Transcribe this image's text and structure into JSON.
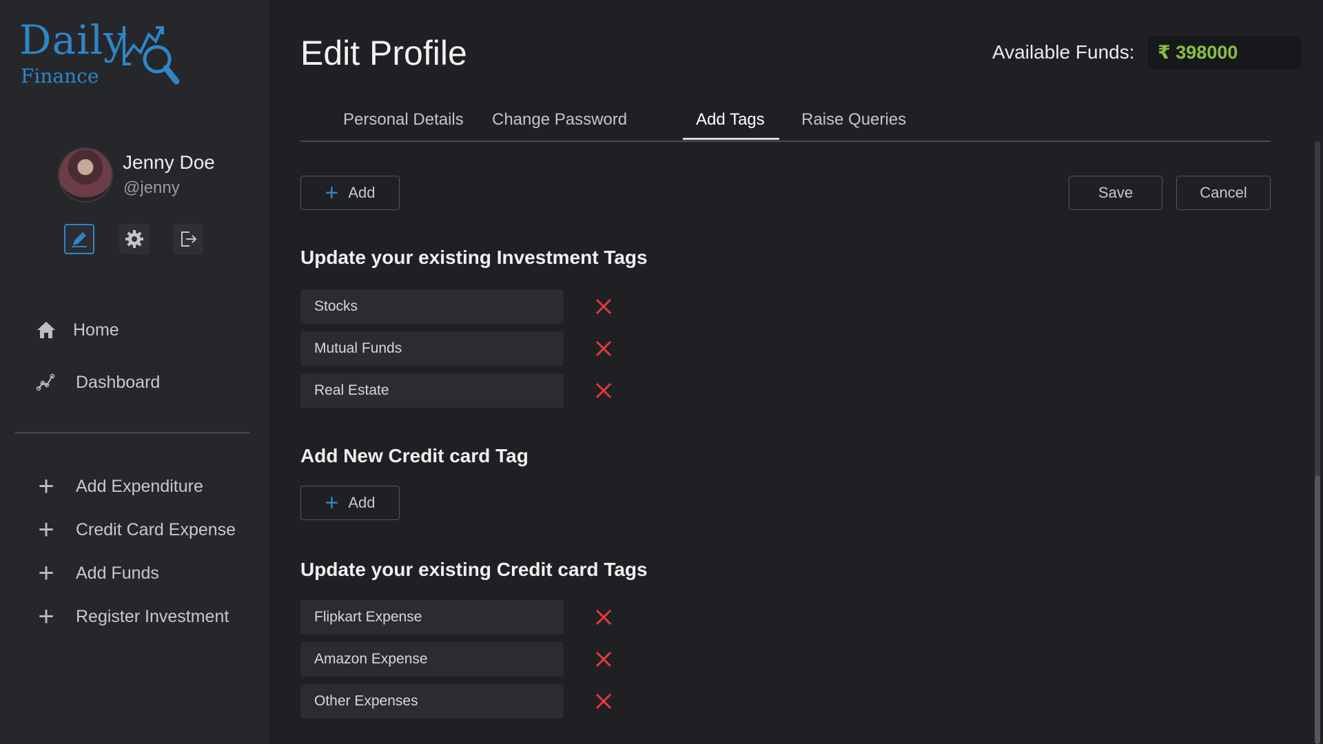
{
  "brand": {
    "name_top": "Daily",
    "name_bottom": "Finance",
    "accent": "#2f86c8"
  },
  "user": {
    "name": "Jenny Doe",
    "handle": "@jenny"
  },
  "quick_actions": [
    {
      "icon": "pencil-icon",
      "label": "Edit"
    },
    {
      "icon": "gear-icon",
      "label": "Settings"
    },
    {
      "icon": "logout-icon",
      "label": "Logout"
    }
  ],
  "nav": {
    "primary": [
      {
        "label": "Home",
        "icon": "home-icon"
      },
      {
        "label": "Dashboard",
        "icon": "chart-icon"
      }
    ],
    "actions": [
      {
        "label": "Add Expenditure",
        "icon": "plus-icon"
      },
      {
        "label": "Credit Card Expense",
        "icon": "plus-icon"
      },
      {
        "label": "Add Funds",
        "icon": "plus-icon"
      },
      {
        "label": "Register Investment",
        "icon": "plus-icon"
      }
    ]
  },
  "header": {
    "title": "Edit Profile",
    "funds_label": "Available Funds:",
    "funds_value": "₹ 398000",
    "funds_color": "#8ac040"
  },
  "tabs": [
    {
      "label": "Personal Details",
      "active": false
    },
    {
      "label": "Change Password",
      "active": false
    },
    {
      "label": "Add Tags",
      "active": true
    },
    {
      "label": "Raise Queries",
      "active": false
    }
  ],
  "toolbar": {
    "add_label": "Add",
    "save_label": "Save",
    "cancel_label": "Cancel"
  },
  "investment_section": {
    "title": "Update your existing Investment Tags",
    "tags": [
      "Stocks",
      "Mutual Funds",
      "Real Estate"
    ]
  },
  "credit_add_section": {
    "title": "Add New Credit card Tag",
    "add_label": "Add"
  },
  "credit_section": {
    "title": "Update your existing Credit card Tags",
    "tags": [
      "Flipkart Expense",
      "Amazon Expense",
      "Other Expenses"
    ]
  },
  "delete_color": "#e53935"
}
